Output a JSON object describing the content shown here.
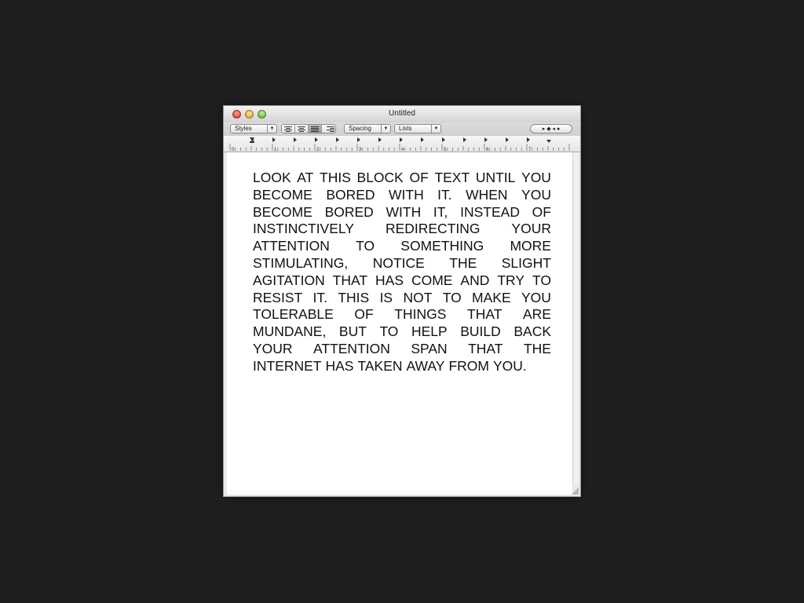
{
  "window": {
    "title": "Untitled"
  },
  "toolbar": {
    "styles_label": "Styles",
    "spacing_label": "Spacing",
    "lists_label": "Lists",
    "alignment_buttons": [
      "align-left",
      "align-center",
      "justify",
      "align-right"
    ],
    "active_alignment": "justify",
    "tab_stops_label": "▸ ◆ ◂ ●"
  },
  "ruler": {
    "numbers": [
      "0",
      "1",
      "2",
      "3",
      "4",
      "5",
      "6",
      "7"
    ]
  },
  "document": {
    "lines": [
      [
        "LOOK",
        "AT",
        "THIS",
        "BLOCK",
        "OF",
        "TEXT",
        "UNTIL",
        "YOU"
      ],
      [
        "BECOME",
        "BORED",
        "WITH",
        "IT.",
        "WHEN",
        "YOU"
      ],
      [
        "BECOME",
        "BORED",
        "WITH",
        "IT,",
        "INSTEAD",
        "OF"
      ],
      [
        "INSTINCTIVELY",
        "REDIRECTING",
        "YOUR"
      ],
      [
        "ATTENTION",
        "TO",
        "SOMETHING",
        "MORE"
      ],
      [
        "STIMULATING,",
        "NOTICE",
        "THE",
        "SLIGHT"
      ],
      [
        "AGITATION",
        "THAT",
        "HAS",
        "COME",
        "AND",
        "TRY",
        "TO"
      ],
      [
        "RESIST",
        "IT.",
        "THIS",
        "IS",
        "NOT",
        "TO",
        "MAKE",
        "YOU"
      ],
      [
        "TOLERABLE",
        "OF",
        "THINGS",
        "THAT",
        "ARE"
      ],
      [
        "MUNDANE,",
        "BUT",
        "TO",
        "HELP",
        "BUILD",
        "BACK"
      ],
      [
        "YOUR",
        "ATTENTION",
        "SPAN",
        "THAT",
        "THE"
      ],
      [
        "INTERNET",
        "HAS",
        "TAKEN",
        "AWAY",
        "FROM",
        "YOU."
      ]
    ]
  },
  "colors": {
    "desktop": "#1f1f1f",
    "close": "#d5301f",
    "minimize": "#e89a12",
    "zoom": "#55a81f"
  }
}
